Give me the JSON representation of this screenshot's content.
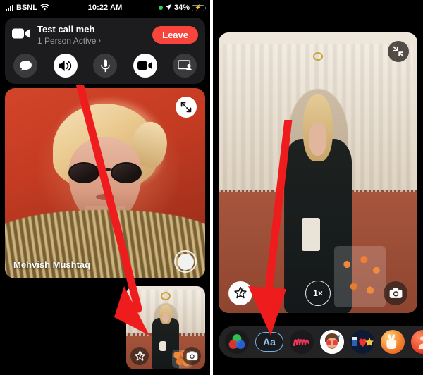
{
  "status_bar": {
    "carrier": "BSNL",
    "time": "10:22 AM",
    "battery_percent": "34%",
    "signal_icon": "signal-bars-icon",
    "wifi_icon": "wifi-icon",
    "location_icon": "location-arrow-icon",
    "recording_dot_icon": "green-recording-dot-icon",
    "battery_icon": "battery-charging-icon"
  },
  "call_header": {
    "video_icon": "video-camera-icon",
    "title": "Test call meh",
    "subtitle": "1 Person Active",
    "chevron": "›",
    "leave_label": "Leave",
    "controls": [
      {
        "name": "chat-button",
        "icon": "chat-bubble-icon",
        "active": false
      },
      {
        "name": "speaker-button",
        "icon": "speaker-icon",
        "active": true
      },
      {
        "name": "microphone-button",
        "icon": "microphone-icon",
        "active": false
      },
      {
        "name": "video-button",
        "icon": "video-camera-icon",
        "active": true
      },
      {
        "name": "screen-share-button",
        "icon": "screen-share-icon",
        "active": false
      }
    ]
  },
  "left_panel": {
    "expand_icon": "expand-arrows-icon",
    "participant_name": "Mehvish Mushtaq",
    "shutter_icon": "shutter-button-icon",
    "pip": {
      "effects_icon": "star-effects-icon",
      "flip_camera_icon": "flip-camera-icon"
    }
  },
  "right_panel": {
    "collapse_icon": "collapse-arrows-icon",
    "effects_icon": "star-effects-icon",
    "zoom_label": "1×",
    "flip_camera_icon": "flip-camera-icon",
    "effects_tray": [
      {
        "name": "effect-filters",
        "icon": "color-filters-icon",
        "label": ""
      },
      {
        "name": "effect-text",
        "icon": "text-aa-icon",
        "label": "Aa"
      },
      {
        "name": "effect-doodle",
        "icon": "doodle-scribble-icon",
        "label": ""
      },
      {
        "name": "effect-sticker",
        "icon": "avatar-sticker-icon",
        "label": ""
      },
      {
        "name": "effect-pack",
        "icon": "heart-star-pack-icon",
        "label": ""
      },
      {
        "name": "effect-hand",
        "icon": "peace-hand-icon",
        "label": ""
      },
      {
        "name": "effect-more",
        "icon": "more-effects-icon",
        "label": ""
      }
    ]
  },
  "annotations": {
    "arrow_color": "#ee1c1c",
    "left_arrow_target": "pip-effects-button",
    "right_arrow_target": "effect-text"
  }
}
